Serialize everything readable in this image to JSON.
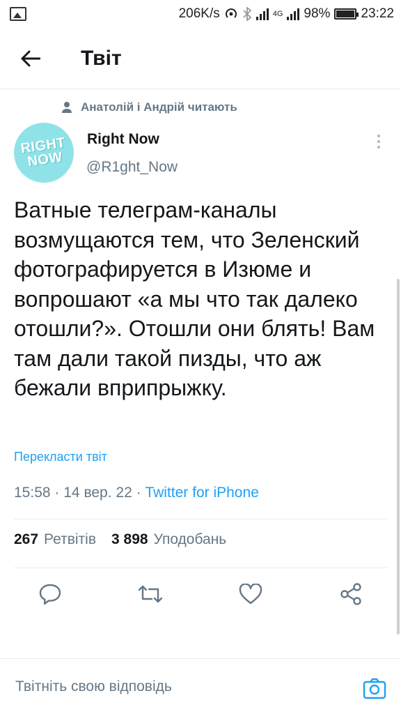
{
  "status_bar": {
    "network_speed": "206K/s",
    "network_type": "4G",
    "battery": "98%",
    "time": "23:22",
    "icons": [
      "image-icon",
      "hotspot-icon",
      "bluetooth-icon",
      "signal-icon",
      "battery-icon"
    ]
  },
  "header": {
    "title": "Твіт",
    "back_icon": "arrow-left-icon"
  },
  "social_context": {
    "text": "Анатолій і Андрій читають",
    "icon": "person-icon"
  },
  "author": {
    "avatar_text_line1": "RIGHT",
    "avatar_text_line2": "NOW",
    "name": "Right Now",
    "handle": "@R1ght_Now"
  },
  "tweet": {
    "text": "Ватные телеграм-каналы возмущаются тем, что Зеленский фотографируется в Изюме и вопрошают «а мы что так далеко отошли?». Отошли они блять! Вам там дали такой пизды, что аж бежали вприпрыжку.",
    "translate_label": "Перекласти твіт",
    "time": "15:58",
    "date": "14 вер. 22",
    "separator": "·",
    "source": "Twitter for iPhone"
  },
  "stats": {
    "retweets_count": "267",
    "retweets_label": "Ретвітів",
    "likes_count": "3 898",
    "likes_label": "Уподобань"
  },
  "actions": [
    "reply-icon",
    "retweet-icon",
    "like-icon",
    "share-icon"
  ],
  "reply": {
    "placeholder": "Твітніть свою відповідь",
    "camera_icon": "camera-icon"
  },
  "colors": {
    "accent": "#1da1f2",
    "secondary_text": "#657786",
    "avatar_bg": "#8fe3e8"
  }
}
